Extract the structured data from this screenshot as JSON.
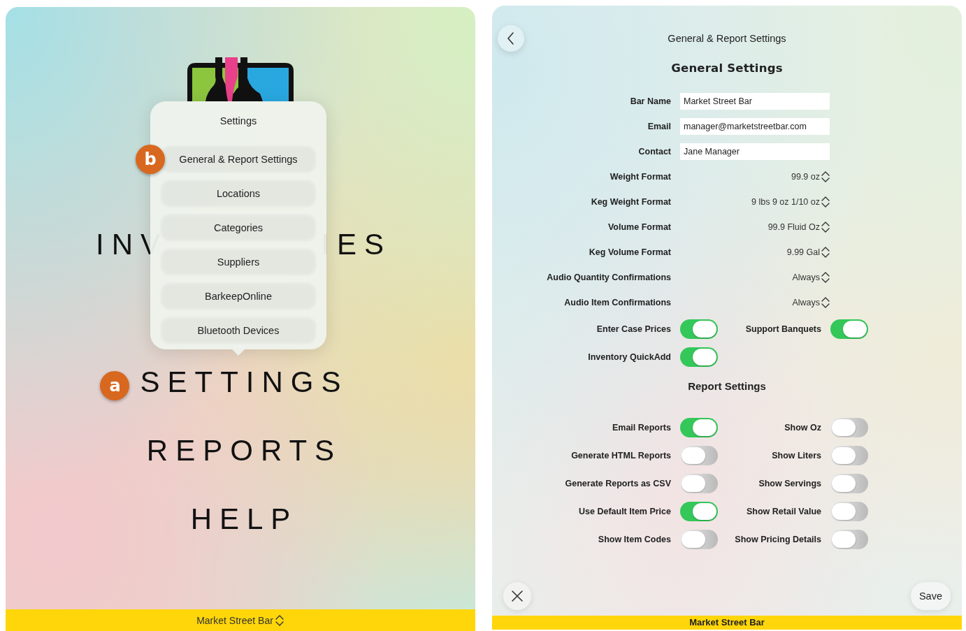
{
  "left_screen": {
    "main_menu": [
      {
        "kind": "split",
        "parts": [
          "INV",
          "IES"
        ]
      },
      {
        "kind": "item",
        "label": "SETTINGS",
        "callout": "a"
      },
      {
        "kind": "item",
        "label": "REPORTS"
      },
      {
        "kind": "item",
        "label": "HELP"
      }
    ],
    "popover": {
      "title": "Settings",
      "items": [
        {
          "label": "General & Report Settings",
          "callout": "b"
        },
        {
          "label": "Locations"
        },
        {
          "label": "Categories"
        },
        {
          "label": "Suppliers"
        },
        {
          "label": "BarkeepOnline"
        },
        {
          "label": "Bluetooth Devices"
        }
      ]
    },
    "bar_switcher": "Market Street Bar"
  },
  "right_screen": {
    "title": "General & Report Settings",
    "sections": [
      {
        "heading": "General Settings",
        "kind": "major",
        "rows": [
          {
            "kind": "field",
            "label": "Bar Name",
            "value": "Market Street Bar"
          },
          {
            "kind": "field",
            "label": "Email",
            "value": "manager@marketstreetbar.com"
          },
          {
            "kind": "field",
            "label": "Contact",
            "value": "Jane Manager"
          },
          {
            "kind": "picker",
            "label": "Weight Format",
            "value": "99.9 oz"
          },
          {
            "kind": "picker",
            "label": "Keg Weight Format",
            "value": "9 lbs 9 oz 1/10 oz"
          },
          {
            "kind": "picker",
            "label": "Volume Format",
            "value": "99.9 Fluid Oz"
          },
          {
            "kind": "picker",
            "label": "Keg Volume Format",
            "value": "9.99 Gal"
          },
          {
            "kind": "picker",
            "label": "Audio Quantity Confirmations",
            "value": "Always"
          },
          {
            "kind": "picker",
            "label": "Audio Item Confirmations",
            "value": "Always"
          },
          {
            "kind": "toggles",
            "items": [
              {
                "label": "Enter Case Prices",
                "on": true
              },
              {
                "label": "Support Banquets",
                "on": true
              }
            ]
          },
          {
            "kind": "toggles",
            "items": [
              {
                "label": "Inventory QuickAdd",
                "on": true
              }
            ]
          }
        ]
      },
      {
        "heading": "Report Settings",
        "kind": "minor",
        "rows": [
          {
            "kind": "toggles",
            "items": [
              {
                "label": "Email Reports",
                "on": true
              },
              {
                "label": "Show Oz",
                "on": false
              }
            ]
          },
          {
            "kind": "toggles",
            "items": [
              {
                "label": "Generate HTML Reports",
                "on": false
              },
              {
                "label": "Show Liters",
                "on": false
              }
            ]
          },
          {
            "kind": "toggles",
            "items": [
              {
                "label": "Generate Reports as CSV",
                "on": false
              },
              {
                "label": "Show Servings",
                "on": false
              }
            ]
          },
          {
            "kind": "toggles",
            "items": [
              {
                "label": "Use Default Item Price",
                "on": true
              },
              {
                "label": "Show Retail Value",
                "on": false
              }
            ]
          },
          {
            "kind": "toggles",
            "items": [
              {
                "label": "Show Item Codes",
                "on": false
              },
              {
                "label": "Show Pricing Details",
                "on": false
              }
            ]
          }
        ]
      }
    ],
    "save_button": "Save",
    "footer_bar": "Market Street Bar"
  }
}
